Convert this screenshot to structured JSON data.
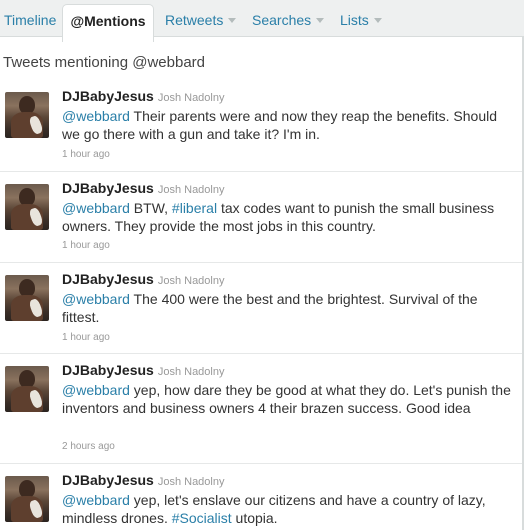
{
  "tabs": [
    {
      "label": "Timeline",
      "active": false,
      "dropdown": false
    },
    {
      "label": "@Mentions",
      "active": true,
      "dropdown": false
    },
    {
      "label": "Retweets",
      "active": false,
      "dropdown": true
    },
    {
      "label": "Searches",
      "active": false,
      "dropdown": true
    },
    {
      "label": "Lists",
      "active": false,
      "dropdown": true
    }
  ],
  "heading": "Tweets mentioning @webbard",
  "colors": {
    "link": "#2a7fa8",
    "tabbar_bg": "#eef0f0"
  },
  "tweets": [
    {
      "screen_name": "DJBabyJesus",
      "real_name": "Josh Nadolny",
      "mention": "@webbard",
      "parts": [
        " Their parents were and now they reap the benefits. Should we go there with a gun and take it? I'm in."
      ],
      "time": "1 hour ago"
    },
    {
      "screen_name": "DJBabyJesus",
      "real_name": "Josh Nadolny",
      "mention": "@webbard",
      "pre": " BTW, ",
      "hashtag": "#liberal",
      "post": " tax codes want to punish the small business owners. They provide the most jobs in this country.",
      "time": "1 hour ago"
    },
    {
      "screen_name": "DJBabyJesus",
      "real_name": "Josh Nadolny",
      "mention": "@webbard",
      "parts": [
        " The 400 were the best and the brightest. Survival of the fittest."
      ],
      "time": "1 hour ago"
    },
    {
      "screen_name": "DJBabyJesus",
      "real_name": "Josh Nadolny",
      "mention": "@webbard",
      "parts": [
        " yep, how dare they be good at what they do. Let's punish the inventors and business owners 4 their brazen success. Good idea"
      ],
      "time": "2 hours ago"
    },
    {
      "screen_name": "DJBabyJesus",
      "real_name": "Josh Nadolny",
      "mention": "@webbard",
      "pre": " yep, let's enslave our citizens and have a country of lazy, mindless drones. ",
      "hashtag": "#Socialist",
      "post": " utopia."
    }
  ]
}
